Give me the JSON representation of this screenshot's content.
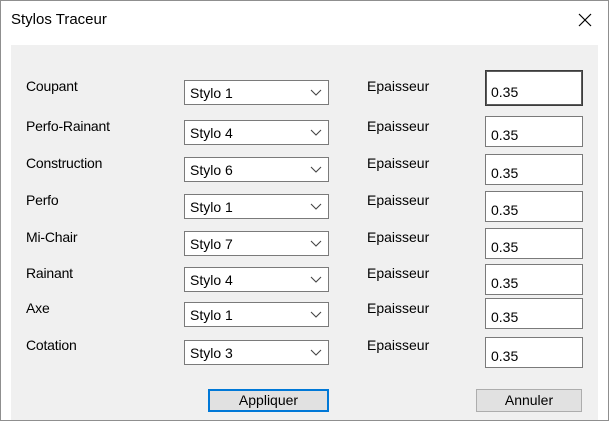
{
  "window": {
    "title": "Stylos Traceur"
  },
  "rows": [
    {
      "label": "Coupant",
      "pen": "Stylo 1",
      "thickness_label": "Epaisseur",
      "thickness": "0.35"
    },
    {
      "label": "Perfo-Rainant",
      "pen": "Stylo 4",
      "thickness_label": "Epaisseur",
      "thickness": "0.35"
    },
    {
      "label": "Construction",
      "pen": "Stylo 6",
      "thickness_label": "Epaisseur",
      "thickness": "0.35"
    },
    {
      "label": "Perfo",
      "pen": "Stylo 1",
      "thickness_label": "Epaisseur",
      "thickness": "0.35"
    },
    {
      "label": "Mi-Chair",
      "pen": "Stylo 7",
      "thickness_label": "Epaisseur",
      "thickness": "0.35"
    },
    {
      "label": "Rainant",
      "pen": "Stylo 4",
      "thickness_label": "Epaisseur",
      "thickness": "0.35"
    },
    {
      "label": "Axe",
      "pen": "Stylo 1",
      "thickness_label": "Epaisseur",
      "thickness": "0.35"
    },
    {
      "label": "Cotation",
      "pen": "Stylo 3",
      "thickness_label": "Epaisseur",
      "thickness": "0.35"
    }
  ],
  "buttons": {
    "apply": "Appliquer",
    "cancel": "Annuler"
  },
  "icons": {
    "close": "close-icon",
    "dropdown": "chevron-down-icon"
  },
  "colors": {
    "client_bg": "#f0f0f0",
    "focus_border": "#0078d7"
  }
}
